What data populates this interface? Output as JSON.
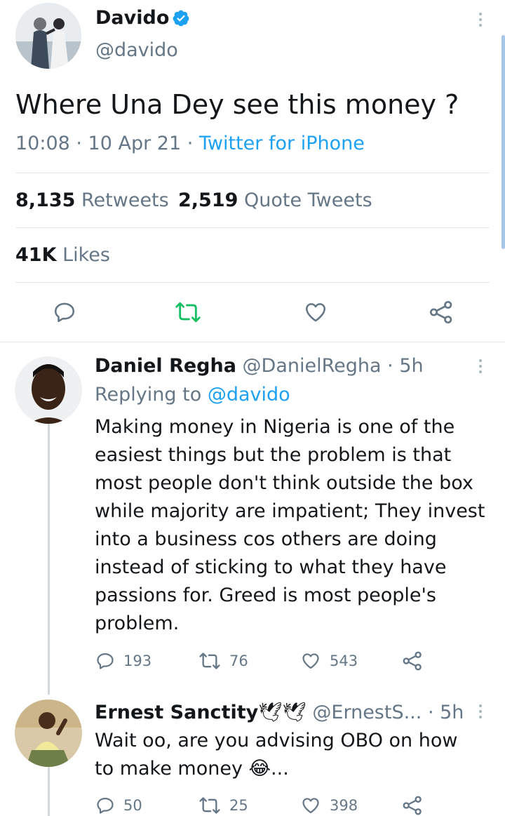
{
  "tweet": {
    "author_name": "Davido",
    "author_handle": "@davido",
    "text": "Where Una Dey see this money ?",
    "time": "10:08 · 10 Apr 21 · ",
    "source": "Twitter for iPhone",
    "retweets_count": "8,135",
    "retweets_label": "Retweets",
    "quotes_count": "2,519",
    "quotes_label": "Quote Tweets",
    "likes_count": "41K",
    "likes_label": "Likes"
  },
  "replies": [
    {
      "author_name": "Daniel Regha",
      "author_handle": "@DanielRegha",
      "time": "· 5h",
      "replying_label": "Replying to ",
      "replying_handle": "@davido",
      "text": "Making money in Nigeria is one of the easiest things but the problem is that most people don't think outside the box while majority are impatient; They invest into a business cos others are doing instead of sticking to what they have passions for. Greed is most people's problem.",
      "reply_count": "193",
      "retweet_count": "76",
      "like_count": "543"
    },
    {
      "author_name": "Ernest Sanctity",
      "author_emoji": "🕊🕊",
      "author_handle": "@ErnestS...",
      "time": "· 5h",
      "text": "Wait oo, are you advising OBO on how to make money 😂...",
      "reply_count": "50",
      "retweet_count": "25",
      "like_count": "398"
    }
  ],
  "icons": {
    "verified": "verified-badge-icon",
    "reply": "reply-icon",
    "retweet": "retweet-icon",
    "like": "heart-icon",
    "share": "share-icon",
    "more": "more-vertical-icon"
  },
  "colors": {
    "accent": "#1da1f2",
    "retweet_green": "#17bf63",
    "muted": "#657786",
    "text": "#14171a"
  }
}
